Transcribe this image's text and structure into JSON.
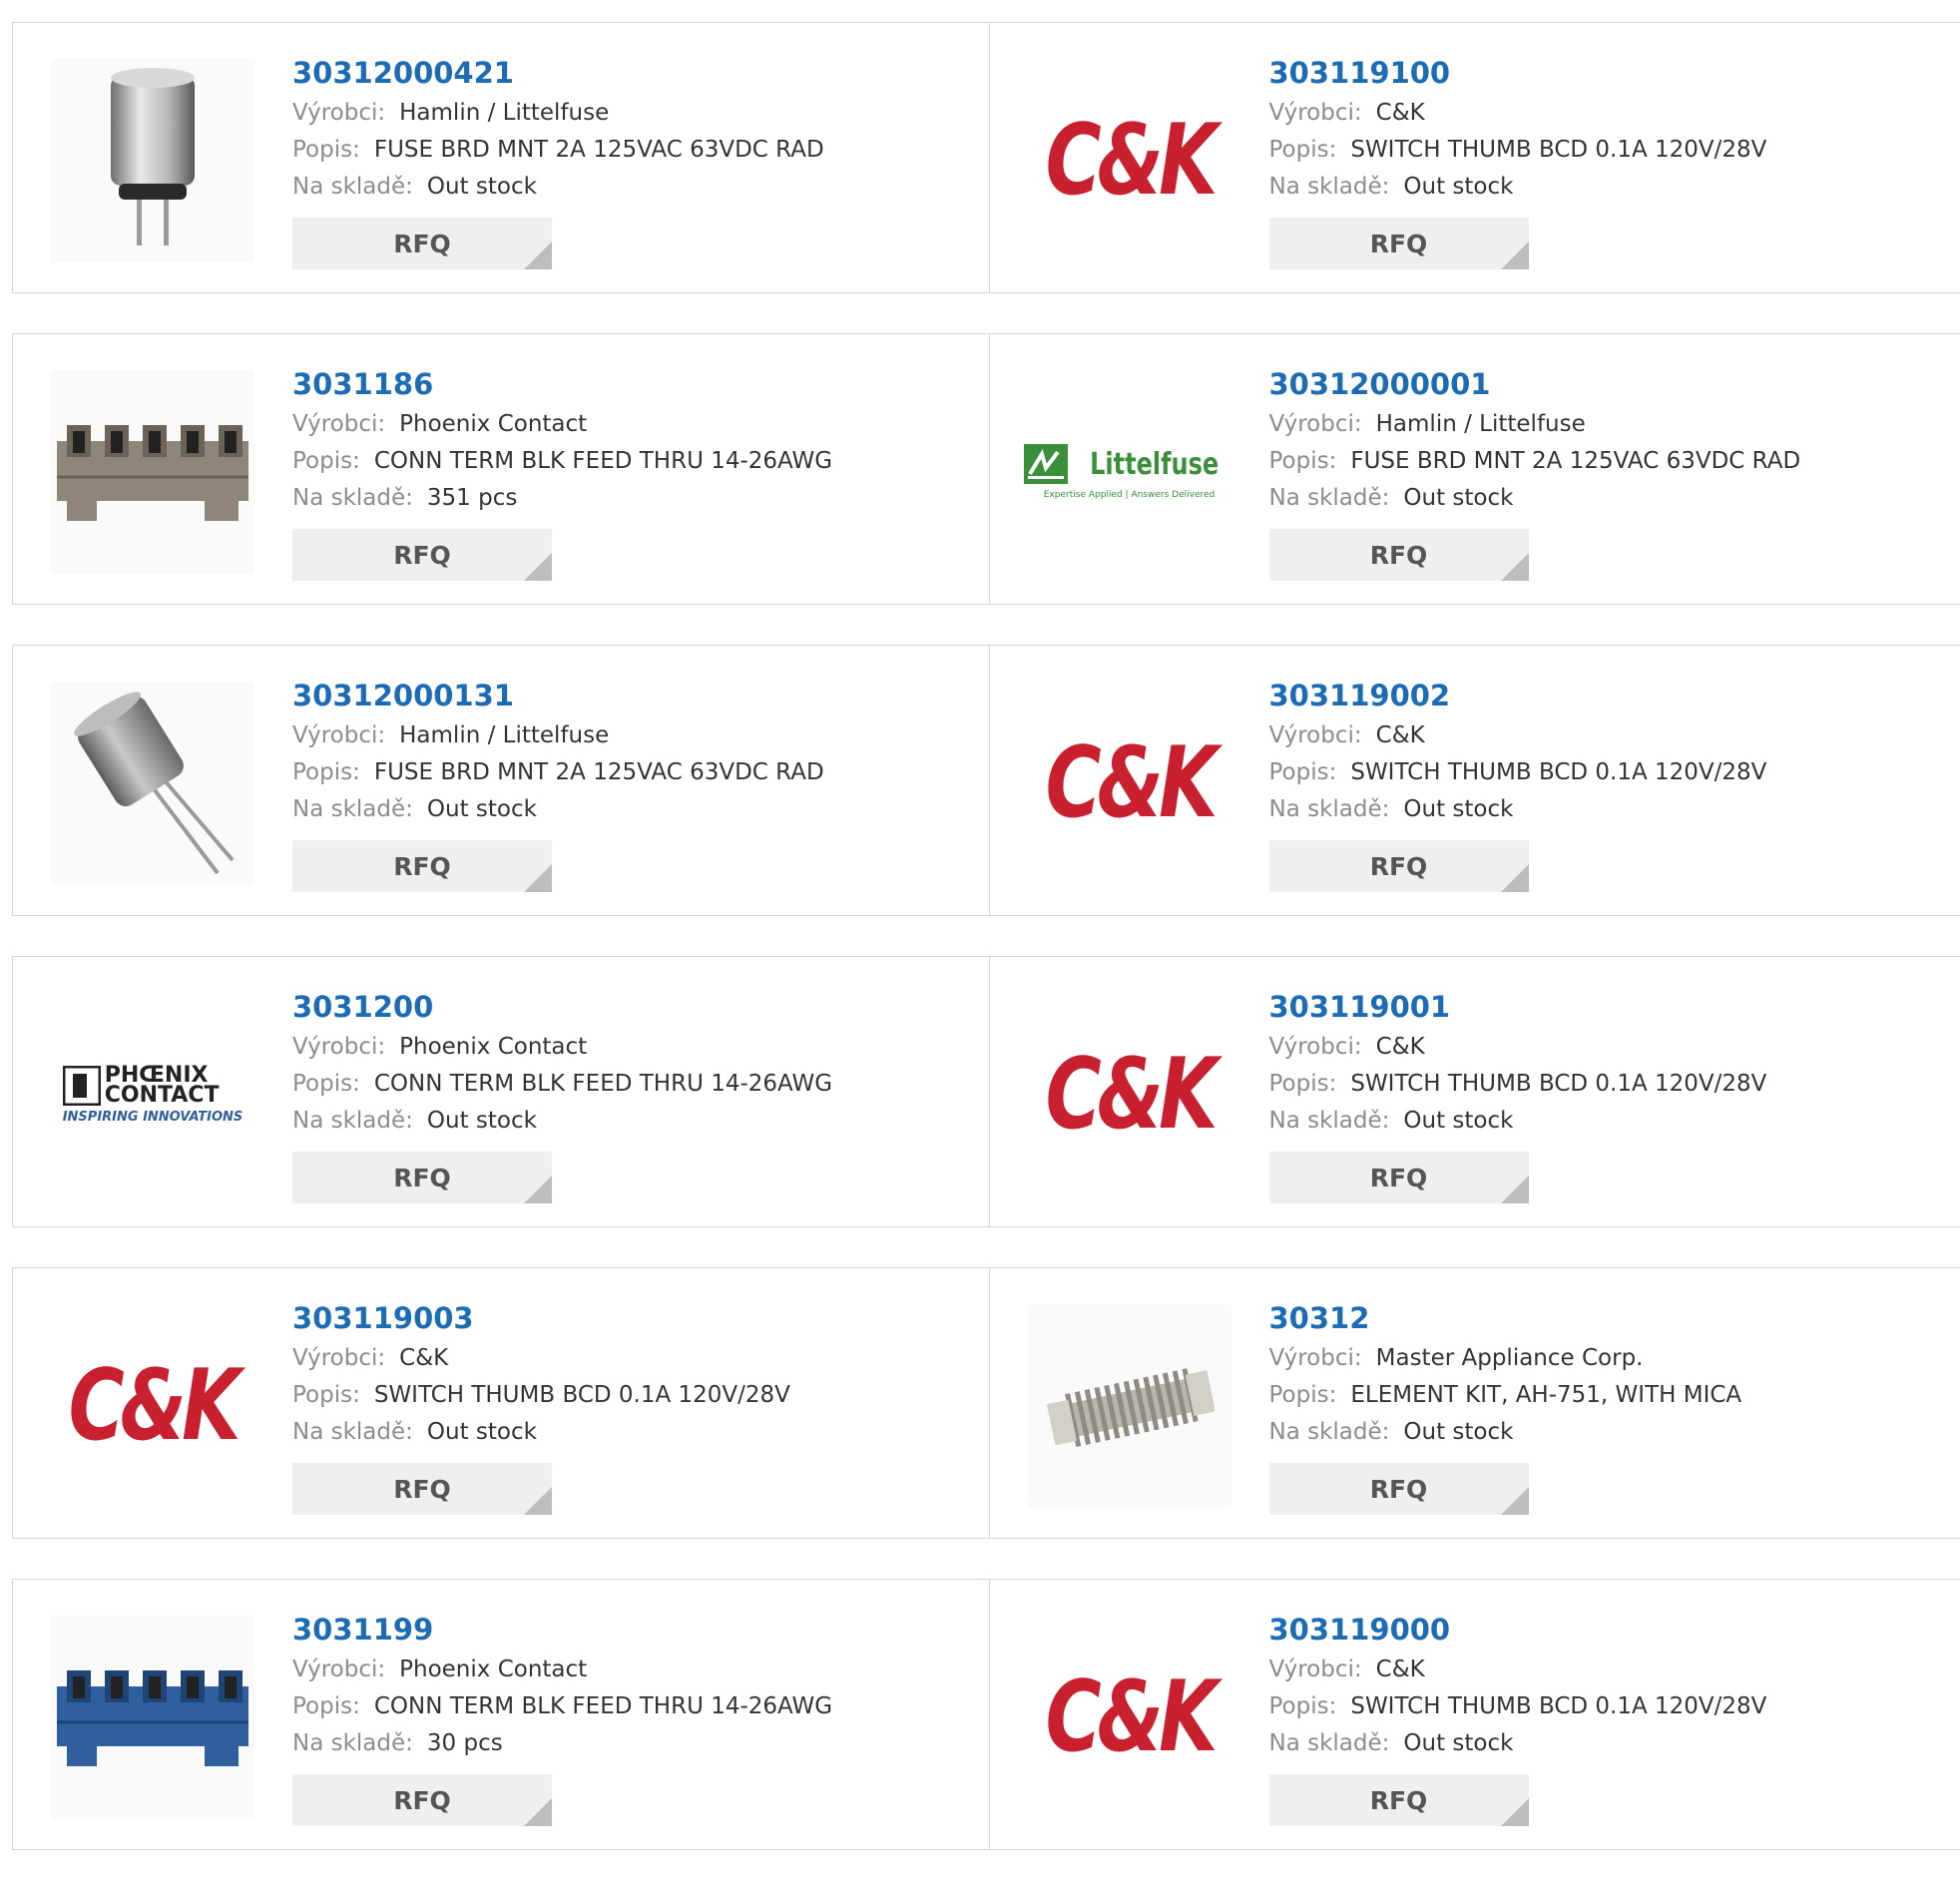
{
  "labels": {
    "manufacturer": "Výrobci:",
    "description": "Popis:",
    "stock": "Na skladě:",
    "rfq": "RFQ"
  },
  "colors": {
    "part_link": "#1b6cb5",
    "ck_red": "#c8202e",
    "littelfuse_green": "#3a8f3a",
    "phoenix_blue": "#2f5f9e"
  },
  "rows": [
    {
      "left": {
        "part": "30312000421",
        "manufacturer": "Hamlin / Littelfuse",
        "description": "FUSE BRD MNT 2A 125VAC 63VDC RAD",
        "stock": "Out stock",
        "image": "fuse-cylinder-image"
      },
      "right": {
        "part": "303119100",
        "manufacturer": "C&K",
        "description": "SWITCH THUMB BCD 0.1A 120V/28V",
        "stock": "Out stock",
        "image": "ck-logo"
      }
    },
    {
      "left": {
        "part": "3031186",
        "manufacturer": "Phoenix Contact",
        "description": "CONN TERM BLK FEED THRU 14-26AWG",
        "stock": "351 pcs",
        "image": "terminal-block-grey-image"
      },
      "right": {
        "part": "30312000001",
        "manufacturer": "Hamlin / Littelfuse",
        "description": "FUSE BRD MNT 2A 125VAC 63VDC RAD",
        "stock": "Out stock",
        "image": "littelfuse-logo"
      }
    },
    {
      "left": {
        "part": "30312000131",
        "manufacturer": "Hamlin / Littelfuse",
        "description": "FUSE BRD MNT 2A 125VAC 63VDC RAD",
        "stock": "Out stock",
        "image": "fuse-angled-image"
      },
      "right": {
        "part": "303119002",
        "manufacturer": "C&K",
        "description": "SWITCH THUMB BCD 0.1A 120V/28V",
        "stock": "Out stock",
        "image": "ck-logo"
      }
    },
    {
      "left": {
        "part": "3031200",
        "manufacturer": "Phoenix Contact",
        "description": "CONN TERM BLK FEED THRU 14-26AWG",
        "stock": "Out stock",
        "image": "phoenix-contact-logo"
      },
      "right": {
        "part": "303119001",
        "manufacturer": "C&K",
        "description": "SWITCH THUMB BCD 0.1A 120V/28V",
        "stock": "Out stock",
        "image": "ck-logo"
      }
    },
    {
      "left": {
        "part": "303119003",
        "manufacturer": "C&K",
        "description": "SWITCH THUMB BCD 0.1A 120V/28V",
        "stock": "Out stock",
        "image": "ck-logo"
      },
      "right": {
        "part": "30312",
        "manufacturer": "Master Appliance Corp.",
        "description": "ELEMENT KIT, AH-751, WITH MICA",
        "stock": "Out stock",
        "image": "heating-element-image"
      }
    },
    {
      "left": {
        "part": "3031199",
        "manufacturer": "Phoenix Contact",
        "description": "CONN TERM BLK FEED THRU 14-26AWG",
        "stock": "30 pcs",
        "image": "terminal-block-blue-image"
      },
      "right": {
        "part": "303119000",
        "manufacturer": "C&K",
        "description": "SWITCH THUMB BCD 0.1A 120V/28V",
        "stock": "Out stock",
        "image": "ck-logo"
      }
    }
  ],
  "logos": {
    "ck_text": "C&K",
    "littelfuse_name": "Littelfuse",
    "littelfuse_tagline": "Expertise Applied | Answers Delivered",
    "phoenix_line1": "PHŒNIX",
    "phoenix_line2": "CONTACT",
    "phoenix_tagline": "INSPIRING INNOVATIONS"
  }
}
